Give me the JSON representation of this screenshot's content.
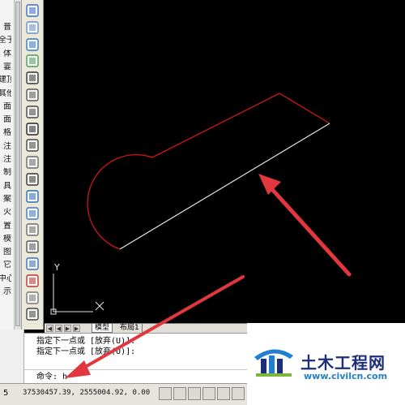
{
  "left_menu": {
    "items": [
      "普",
      "全子",
      "体",
      "霎",
      "建顶",
      "其他",
      "面",
      "面",
      "格",
      "注",
      "注",
      "制",
      "具",
      "案",
      "火",
      "置",
      "模",
      "图",
      "它",
      "中心",
      "示"
    ]
  },
  "toolbar": {
    "icons": [
      "layer-icon",
      "zoom-icon",
      "grid-icon",
      "image-icon",
      "polyline-icon",
      "dimension-icon",
      "align-icon",
      "text-icon",
      "leader-icon",
      "elevation-icon",
      "tag-icon",
      "hatch-icon",
      "table-icon",
      "block-icon",
      "clip-icon",
      "section-icon",
      "fire-icon",
      "note-icon",
      "view-icon"
    ]
  },
  "tabs": {
    "model": "模型",
    "layout": "布局1"
  },
  "command": {
    "line1": "指定下一点或 [放弃(U)]:",
    "line2": "指定下一点或 [放弃(U)]:",
    "prompt": "命令: h"
  },
  "status": {
    "number": "5",
    "coords": "37530457.39, 2555004.92, 0.00"
  },
  "ucs": {
    "x_label": "X",
    "y_label": "Y"
  },
  "watermark": {
    "title": "土木工程网",
    "url": "www.civilcn.com"
  },
  "colors": {
    "canvas": "#000000",
    "red_line": "#cc1616",
    "white_line": "#e6e6e6",
    "arrow": "#e0383e",
    "watermark_title": "#1d2d7a",
    "watermark_url": "#1f7fd0"
  }
}
